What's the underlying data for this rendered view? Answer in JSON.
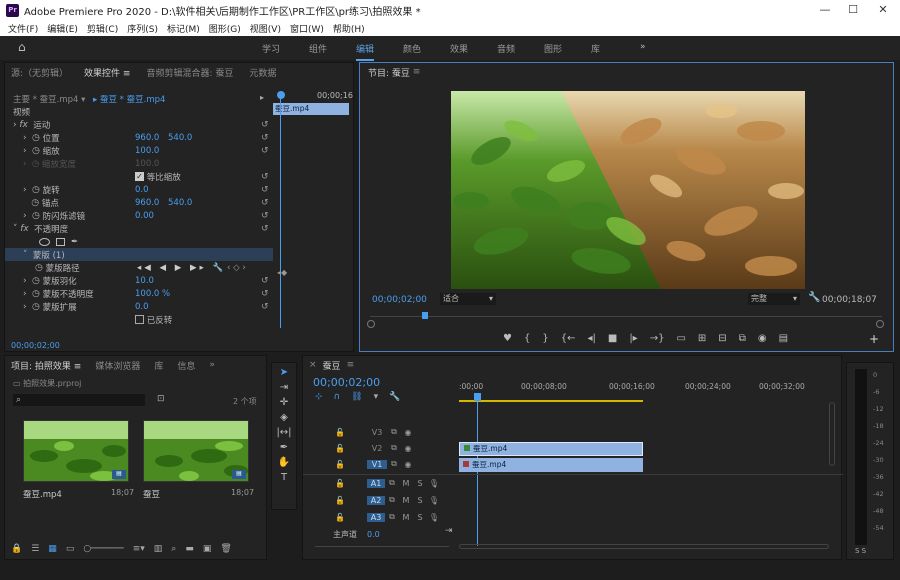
{
  "window": {
    "title": "Adobe Premiere Pro 2020 - D:\\软件相关\\后期制作工作区\\PR工作区\\pr练习\\拍照效果 *",
    "logo": "Pr"
  },
  "menu": [
    "文件(F)",
    "编辑(E)",
    "剪辑(C)",
    "序列(S)",
    "标记(M)",
    "图形(G)",
    "视图(V)",
    "窗口(W)",
    "帮助(H)"
  ],
  "workspaces": [
    "学习",
    "组件",
    "编辑",
    "颜色",
    "效果",
    "音频",
    "图形",
    "库"
  ],
  "active_workspace": "编辑",
  "effect_panel": {
    "tabs": [
      "源:（无剪辑）",
      "效果控件",
      "音频剪辑混合器: 蚕豆",
      "元数据"
    ],
    "source_label": "主要 * 蚕豆.mp4",
    "clip_label": "蚕豆 * 蚕豆.mp4",
    "ruler_time": "00;00;16",
    "mini_clip": "蚕豆.mp4",
    "video_label": "视频",
    "motion": "运动",
    "position": {
      "label": "位置",
      "x": "960.0",
      "y": "540.0"
    },
    "scale": {
      "label": "缩放",
      "value": "100.0"
    },
    "scale_width": {
      "label": "缩放宽度",
      "value": "100.0"
    },
    "uniform_scale": "等比缩放",
    "rotation": {
      "label": "旋转",
      "value": "0.0"
    },
    "anchor": {
      "label": "锚点",
      "x": "960.0",
      "y": "540.0"
    },
    "anti_flicker": {
      "label": "防闪烁滤镜",
      "value": "0.00"
    },
    "opacity": "不透明度",
    "mask": "蒙版 (1)",
    "mask_path": "蒙版路径",
    "mask_feather": {
      "label": "蒙版羽化",
      "value": "10.0"
    },
    "mask_opacity": {
      "label": "蒙版不透明度",
      "value": "100.0 %"
    },
    "mask_expansion": {
      "label": "蒙版扩展",
      "value": "0.0"
    },
    "inverted": "已反转",
    "timecode": "00;00;02;00"
  },
  "program_monitor": {
    "title": "节目: 蚕豆",
    "timecode": "00;00;02;00",
    "fit": "适合",
    "quality": "完整",
    "duration": "00;00;18;07"
  },
  "project_panel": {
    "tabs": [
      "项目: 拍照效果",
      "媒体浏览器",
      "库",
      "信息"
    ],
    "project_file": "拍照效果.prproj",
    "item_count": "2 个项",
    "items": [
      {
        "name": "蚕豆.mp4",
        "duration": "18;07"
      },
      {
        "name": "蚕豆",
        "duration": "18;07"
      }
    ]
  },
  "timeline": {
    "sequence": "蚕豆",
    "timecode": "00;00;02;00",
    "ruler": [
      ":00;00",
      "00;00;08;00",
      "00;00;16;00",
      "00;00;24;00",
      "00;00;32;00"
    ],
    "tracks": {
      "video": [
        "V3",
        "V2",
        "V1"
      ],
      "audio": [
        "A1",
        "A2",
        "A3"
      ],
      "master": "主声道",
      "master_value": "0.0"
    },
    "clips": [
      {
        "track": "V2",
        "label": "蚕豆.mp4"
      },
      {
        "track": "V1",
        "label": "蚕豆.mp4"
      }
    ]
  },
  "audio_meter": {
    "scale": [
      "0",
      "-6",
      "-12",
      "-18",
      "-24",
      "-30",
      "-36",
      "-42",
      "-48",
      "-54"
    ],
    "solo": "S S"
  },
  "colors": {
    "accent": "#4a9eef",
    "clip": "#8fb2e0",
    "panel": "#232323",
    "bg": "#1d1d1d"
  }
}
